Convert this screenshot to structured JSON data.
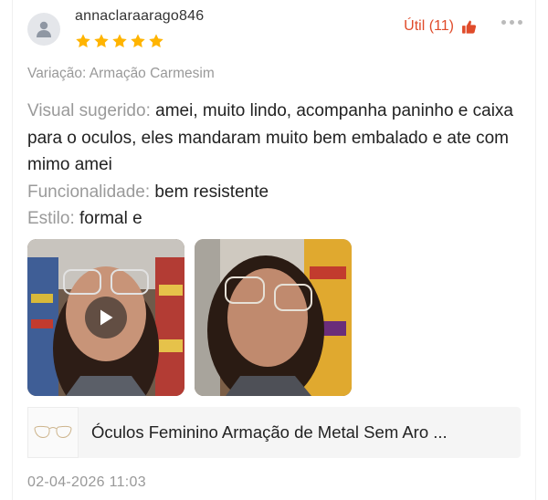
{
  "review": {
    "username": "annaclaraarago846",
    "rating": 5,
    "helpful_label": "Útil (11)",
    "variation": "Variação: Armação Carmesim",
    "fields": [
      {
        "label": "Visual sugerido:",
        "value": " amei, muito lindo, acompanha paninho e caixa para o oculos, eles mandaram muito bem embalado e ate com mimo amei"
      },
      {
        "label": "Funcionalidade:",
        "value": " bem resistente"
      },
      {
        "label": "Estilo:",
        "value": " formal e"
      }
    ],
    "product_title": "Óculos Feminino Armação de Metal Sem Aro ...",
    "date": "02-04-2026 11:03"
  },
  "colors": {
    "accent": "#e04b2a",
    "star": "#ffb400",
    "muted": "#999999"
  },
  "icons": {
    "avatar": "user-icon",
    "helpful": "thumbs-up-icon",
    "more": "more-dots-icon",
    "play": "play-icon",
    "star": "star-icon"
  }
}
